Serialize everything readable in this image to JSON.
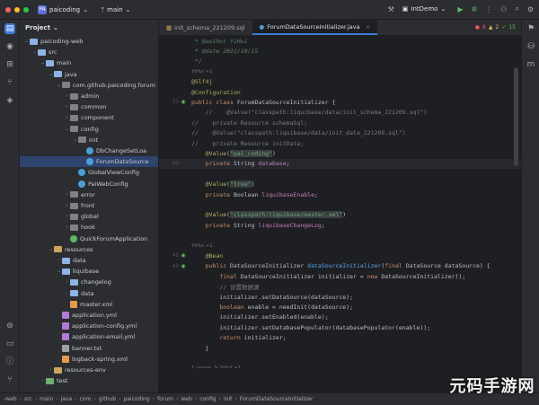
{
  "titlebar": {
    "project_badge": "PA",
    "project_name": "paicoding",
    "branch": "main",
    "run_config": "IntDemo",
    "icons": [
      "hammer-icon",
      "run-icon",
      "debug-icon",
      "more-icon",
      "account-icon",
      "search-icon",
      "settings-icon"
    ]
  },
  "project_panel": {
    "title": "Project",
    "tree": [
      {
        "label": "paicoding-web",
        "indent": 0,
        "arrow": "down",
        "kind": "folder",
        "selected": false
      },
      {
        "label": "src",
        "indent": 1,
        "arrow": "down",
        "kind": "folder",
        "selected": false
      },
      {
        "label": "main",
        "indent": 2,
        "arrow": "down",
        "kind": "folder",
        "selected": false
      },
      {
        "label": "java",
        "indent": 3,
        "arrow": "down",
        "kind": "folder",
        "selected": false
      },
      {
        "label": "com.github.paicoding.forum",
        "indent": 4,
        "arrow": "down",
        "kind": "pkg",
        "selected": false
      },
      {
        "label": "admin",
        "indent": 5,
        "arrow": "right",
        "kind": "pkg",
        "selected": false
      },
      {
        "label": "common",
        "indent": 5,
        "arrow": "right",
        "kind": "pkg",
        "selected": false
      },
      {
        "label": "component",
        "indent": 5,
        "arrow": "right",
        "kind": "pkg",
        "selected": false
      },
      {
        "label": "config",
        "indent": 5,
        "arrow": "down",
        "kind": "pkg",
        "selected": false
      },
      {
        "label": "init",
        "indent": 6,
        "arrow": "down",
        "kind": "pkg",
        "selected": false
      },
      {
        "label": "DbChangeSetLoa",
        "indent": 7,
        "arrow": "",
        "kind": "cls",
        "selected": false
      },
      {
        "label": "ForumDataSource",
        "indent": 7,
        "arrow": "",
        "kind": "cls",
        "selected": true
      },
      {
        "label": "GlobalViewConfig",
        "indent": 6,
        "arrow": "",
        "kind": "cls",
        "selected": false
      },
      {
        "label": "PaiWebConfig",
        "indent": 6,
        "arrow": "",
        "kind": "cls",
        "selected": false
      },
      {
        "label": "error",
        "indent": 5,
        "arrow": "right",
        "kind": "pkg",
        "selected": false
      },
      {
        "label": "front",
        "indent": 5,
        "arrow": "right",
        "kind": "pkg",
        "selected": false
      },
      {
        "label": "global",
        "indent": 5,
        "arrow": "right",
        "kind": "pkg",
        "selected": false
      },
      {
        "label": "hook",
        "indent": 5,
        "arrow": "right",
        "kind": "pkg",
        "selected": false
      },
      {
        "label": "QuickForumApplication",
        "indent": 5,
        "arrow": "",
        "kind": "app",
        "selected": false
      },
      {
        "label": "resources",
        "indent": 3,
        "arrow": "down",
        "kind": "res",
        "selected": false
      },
      {
        "label": "data",
        "indent": 4,
        "arrow": "right",
        "kind": "folder",
        "selected": false
      },
      {
        "label": "liquibase",
        "indent": 4,
        "arrow": "down",
        "kind": "folder",
        "selected": false
      },
      {
        "label": "changelog",
        "indent": 5,
        "arrow": "right",
        "kind": "folder",
        "selected": false
      },
      {
        "label": "data",
        "indent": 5,
        "arrow": "right",
        "kind": "folder",
        "selected": false
      },
      {
        "label": "master.xml",
        "indent": 5,
        "arrow": "",
        "kind": "xml",
        "selected": false
      },
      {
        "label": "application.yml",
        "indent": 4,
        "arrow": "",
        "kind": "yml",
        "selected": false
      },
      {
        "label": "application-config.yml",
        "indent": 4,
        "arrow": "",
        "kind": "yml",
        "selected": false
      },
      {
        "label": "application-email.yml",
        "indent": 4,
        "arrow": "",
        "kind": "yml",
        "selected": false
      },
      {
        "label": "banner.txt",
        "indent": 4,
        "arrow": "",
        "kind": "txt",
        "selected": false
      },
      {
        "label": "logback-spring.xml",
        "indent": 4,
        "arrow": "",
        "kind": "xml",
        "selected": false
      },
      {
        "label": "resources-env",
        "indent": 3,
        "arrow": "right",
        "kind": "res",
        "selected": false
      },
      {
        "label": "test",
        "indent": 2,
        "arrow": "right",
        "kind": "tst",
        "selected": false
      }
    ]
  },
  "tabs": [
    {
      "label": "init_schema_221209.sql",
      "active": false
    },
    {
      "label": "ForumDataSourceInitializer.java",
      "active": true
    }
  ],
  "inspections": {
    "errors": "6",
    "warnings": "2",
    "weak": "15"
  },
  "editor": {
    "lines": [
      {
        "num": "",
        "hint": "",
        "html": "<span class=\"cmd\"> * @author YiHui</span>"
      },
      {
        "num": "",
        "hint": "",
        "html": "<span class=\"cmd\"> * @date 2022/10/15</span>"
      },
      {
        "num": "",
        "hint": "",
        "html": "<span class=\"cmd\"> */</span>"
      },
      {
        "num": "",
        "hint": "YiHui +1",
        "html": ""
      },
      {
        "num": "",
        "hint": "",
        "html": "<span class=\"an\">@Slf4j</span>"
      },
      {
        "num": "",
        "hint": "",
        "html": "<span class=\"an\">@Configuration</span>"
      },
      {
        "num": "33",
        "mark": "class",
        "hint": "",
        "html": "<span class=\"kw\">public class</span> ForumDataSourceInitializer {"
      },
      {
        "num": "",
        "hint": "",
        "html": "<span class=\"cm\">    //    @Value(\"classpath:liquibase/data/init_schema_221209.sql\")</span>"
      },
      {
        "num": "",
        "hint": "",
        "html": "<span class=\"cm\">//    private Resource schemaSql;</span>"
      },
      {
        "num": "",
        "hint": "",
        "html": "<span class=\"cm\">//    @Value(\"classpath:liquibase/data/init_data_221209.sql\")</span>"
      },
      {
        "num": "",
        "hint": "",
        "html": "<span class=\"cm\">//    private Resource initData;</span>"
      },
      {
        "num": "",
        "hint": "",
        "html": "    <span class=\"an\">@Value</span>(<span class=\"strbg\">\"pai_coding\"</span>)"
      },
      {
        "num": "40",
        "hint": "",
        "hl": true,
        "html": "    <span class=\"kw\">private</span> String <span class=\"fld\">database</span>;"
      },
      {
        "num": "",
        "hint": "",
        "html": ""
      },
      {
        "num": "",
        "hint": "",
        "html": "    <span class=\"an\">@Value</span>(<span class=\"strbg\">\"true\"</span>)"
      },
      {
        "num": "",
        "hint": "",
        "html": "    <span class=\"kw\">private</span> Boolean <span class=\"fld\">liquibaseEnable</span>;"
      },
      {
        "num": "",
        "hint": "",
        "html": ""
      },
      {
        "num": "",
        "hint": "",
        "html": "    <span class=\"an\">@Value</span>(<span class=\"strbg\">\"classpath:liquibase/master.xml\"</span>)"
      },
      {
        "num": "",
        "hint": "",
        "html": "    <span class=\"kw\">private</span> String <span class=\"fld\">liquibaseChangeLog</span>;"
      },
      {
        "num": "",
        "hint": "",
        "html": ""
      },
      {
        "num": "",
        "hint": "YiHui +1",
        "html": ""
      },
      {
        "num": "48",
        "mark": "bean",
        "hint": "",
        "html": "    <span class=\"an\">@Bean</span>"
      },
      {
        "num": "49",
        "mark": "bean",
        "hint": "",
        "html": "    <span class=\"kw\">public</span> DataSourceInitializer <span class=\"fn\">dataSourceInitializer</span>(<span class=\"kw\">final</span> DataSource dataSource) {"
      },
      {
        "num": "",
        "hint": "",
        "html": "        <span class=\"kw\">final</span> DataSourceInitializer initializer = <span class=\"kw\">new</span> DataSourceInitializer();"
      },
      {
        "num": "",
        "hint": "",
        "html": "        <span class=\"cm\">// 设置数据源</span>"
      },
      {
        "num": "",
        "hint": "",
        "html": "        initializer.setDataSource(dataSource);"
      },
      {
        "num": "",
        "hint": "",
        "html": "        <span class=\"kw\">boolean</span> enable = needInit(dataSource);"
      },
      {
        "num": "",
        "hint": "",
        "html": "        initializer.setEnabled(enable);"
      },
      {
        "num": "",
        "hint": "",
        "html": "        initializer.setDatabasePopulator(databasePopulator(enable));"
      },
      {
        "num": "",
        "hint": "",
        "html": "        <span class=\"kw\">return</span> initializer;"
      },
      {
        "num": "",
        "hint": "",
        "html": "    }"
      },
      {
        "num": "",
        "hint": "",
        "html": ""
      },
      {
        "num": "",
        "hint": "1 usage  ✎ YiHui +1",
        "html": ""
      },
      {
        "num": "60",
        "mark": "method",
        "hint": "",
        "html": "    <span class=\"kw\">private</span> DatabasePopulator <span class=\"fn\">databasePopulator</span>(<span class=\"kw\">boolean</span> initEnable) {"
      },
      {
        "num": "",
        "hint": "",
        "html": "        <span class=\"kw\">final</span> ResourceDatabasePopulator <span class=\"fld\">populator</span> = <span class=\"kw\">new</span> ResourceDatabasePopulator();"
      }
    ]
  },
  "statusbar": {
    "crumbs": [
      "-web",
      "src",
      "main",
      "java",
      "com",
      "github",
      "paicoding",
      "forum",
      "web",
      "config",
      "init",
      "ForumDataSourceInitializer"
    ]
  },
  "watermark": "元码手游网"
}
